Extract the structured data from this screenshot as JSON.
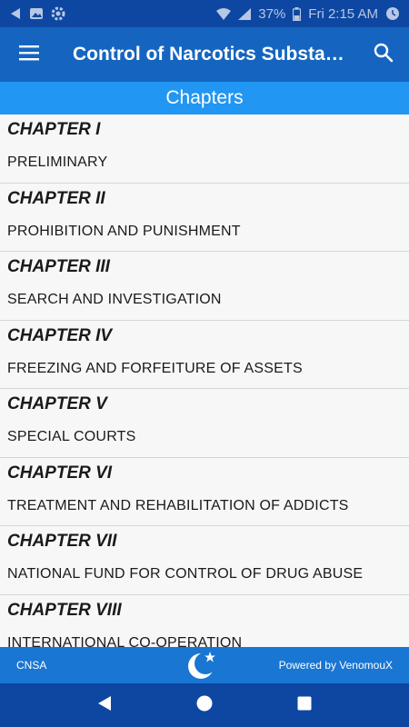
{
  "status_bar": {
    "battery": "37%",
    "time": "Fri 2:15 AM"
  },
  "app_bar": {
    "title": "Control of Narcotics Substan…"
  },
  "section_header": {
    "title": "Chapters"
  },
  "chapters": [
    {
      "number": "CHAPTER I",
      "title": "PRELIMINARY"
    },
    {
      "number": "CHAPTER II",
      "title": "PROHIBITION AND PUNISHMENT"
    },
    {
      "number": "CHAPTER III",
      "title": "SEARCH AND INVESTIGATION"
    },
    {
      "number": "CHAPTER IV",
      "title": "FREEZING AND FORFEITURE OF ASSETS"
    },
    {
      "number": "CHAPTER V",
      "title": "SPECIAL COURTS"
    },
    {
      "number": "CHAPTER VI",
      "title": "TREATMENT AND REHABILITATION OF ADDICTS"
    },
    {
      "number": "CHAPTER VII",
      "title": "NATIONAL FUND FOR CONTROL OF DRUG ABUSE"
    },
    {
      "number": "CHAPTER VIII",
      "title": "INTERNATIONAL CO-OPERATION"
    }
  ],
  "footer": {
    "left_label": "CNSA",
    "right_label": "Powered by VenomouX",
    "logo_icon": "crescent-star-icon"
  },
  "colors": {
    "status_bar": "#0d47a1",
    "app_bar": "#1565c0",
    "section_header": "#2196f3",
    "footer": "#1976d2",
    "nav_bar": "#0d47a1"
  }
}
